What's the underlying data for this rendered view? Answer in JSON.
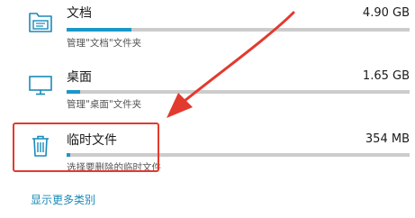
{
  "storage_categories": [
    {
      "name": "文档",
      "size": "4.90 GB",
      "subtitle": "管理\"文档\"文件夹",
      "usage_fraction": 0.19,
      "icon": "documents-folder-icon"
    },
    {
      "name": "桌面",
      "size": "1.65 GB",
      "subtitle": "管理\"桌面\"文件夹",
      "usage_fraction": 0.04,
      "icon": "monitor-icon"
    },
    {
      "name": "临时文件",
      "size": "354 MB",
      "subtitle": "选择要删除的临时文件",
      "usage_fraction": 0.01,
      "icon": "trash-icon"
    }
  ],
  "more_link": "显示更多类别",
  "colors": {
    "accent": "#1a98c9",
    "icon": "#1a8ab8",
    "track": "#cccccc",
    "annotation": "#e23a2e",
    "link": "#1a8ab8"
  }
}
